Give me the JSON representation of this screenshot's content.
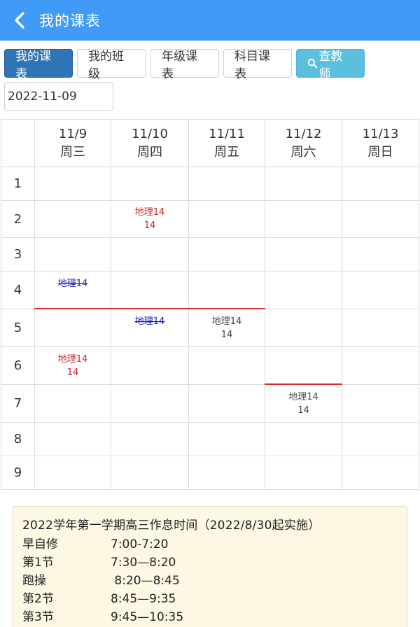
{
  "header": {
    "title": "我的课表"
  },
  "tabs": [
    {
      "label": "我的课表"
    },
    {
      "label": "我的班级"
    },
    {
      "label": "年级课表"
    },
    {
      "label": "科目课表"
    },
    {
      "label": "查教师"
    }
  ],
  "date_value": "2022-11-09",
  "days": [
    {
      "date": "11/9",
      "weekday": "周三"
    },
    {
      "date": "11/10",
      "weekday": "周四"
    },
    {
      "date": "11/11",
      "weekday": "周五"
    },
    {
      "date": "11/12",
      "weekday": "周六"
    },
    {
      "date": "11/13",
      "weekday": "周日"
    }
  ],
  "periods": [
    "1",
    "2",
    "3",
    "4",
    "5",
    "6",
    "7",
    "8",
    "9"
  ],
  "courses": {
    "p2_d2": {
      "name": "地理14",
      "room": "14"
    },
    "p4_d1": {
      "name": "地理14"
    },
    "p5_d2": {
      "name": "地理14"
    },
    "p5_d3": {
      "name": "地理14",
      "room": "14"
    },
    "p6_d1": {
      "name": "地理14",
      "room": "14"
    },
    "p7_d4": {
      "name": "地理14",
      "room": "14"
    }
  },
  "colors": {
    "topbar": "#3f9bf6",
    "active_tab": "#2f74b5",
    "info_tab": "#5bc0de",
    "course_red": "#c62828",
    "course_blue": "#1a1ab8",
    "current_line": "#d32f2f",
    "notice_bg": "#fcf8e3"
  },
  "icons": {
    "back": "chevron-left-icon",
    "search": "search-icon"
  },
  "notice": {
    "title": "2022学年第一学期高三作息时间（2022/8/30起实施）",
    "rows": [
      {
        "label": "早自修",
        "time": "7:00-7:20"
      },
      {
        "label": "第1节",
        "time": "7:30—8:20"
      },
      {
        "label": "跑操",
        "time": " 8:20—8:45"
      },
      {
        "label": "第2节",
        "time": "8:45—9:35"
      },
      {
        "label": "第3节",
        "time": "9:45—10:35"
      }
    ]
  }
}
